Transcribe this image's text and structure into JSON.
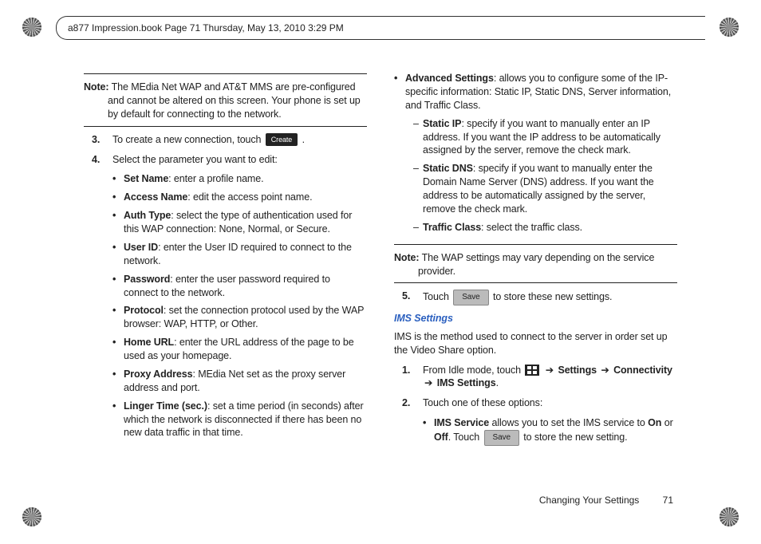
{
  "header": "a877 Impression.book  Page 71  Thursday, May 13, 2010  3:29 PM",
  "col1": {
    "note_label": "Note:",
    "note_text": "The MEdia Net WAP and AT&T MMS are pre-configured and cannot be altered on this screen. Your phone is set up by default for connecting to the network.",
    "step3": {
      "num": "3.",
      "text_before": "To create a new connection, touch ",
      "btn": "Create",
      "text_after": "."
    },
    "step4": {
      "num": "4.",
      "text": "Select the parameter you want to edit:"
    },
    "items": {
      "set_name": {
        "label": "Set Name",
        "desc": ": enter a profile name."
      },
      "access_name": {
        "label": "Access Name",
        "desc": ": edit the access point name."
      },
      "auth_type": {
        "label": "Auth Type",
        "desc": ": select the type of authentication used for this WAP connection: None, Normal, or Secure."
      },
      "user_id": {
        "label": "User ID",
        "desc": ": enter the User ID required to connect to the network."
      },
      "password": {
        "label": "Password",
        "desc": ": enter the user password required to connect to the network."
      },
      "protocol": {
        "label": "Protocol",
        "desc": ": set the connection protocol used by the WAP browser: WAP, HTTP, or Other."
      },
      "home_url": {
        "label": "Home URL",
        "desc": ": enter the URL address of the page to be used as your homepage."
      },
      "proxy": {
        "label": "Proxy Address",
        "desc": ": MEdia Net set as the proxy server address and port."
      },
      "linger": {
        "label": "Linger Time (sec.)",
        "desc": ": set a time period (in seconds) after which the network is disconnected if there has been no new data traffic in that time."
      }
    }
  },
  "col2": {
    "adv": {
      "label": "Advanced Settings",
      "desc": ": allows you to configure some of the IP-specific information: Static IP, Static DNS, Server information, and Traffic Class."
    },
    "static_ip": {
      "label": "Static IP",
      "desc": ": specify if you want to manually enter an IP address. If you want the IP address to be automatically assigned by the server, remove the check mark."
    },
    "static_dns": {
      "label": "Static DNS",
      "desc": ": specify if you want to manually enter the Domain Name Server (DNS) address. If you want the address to be automatically assigned by the server, remove the check mark."
    },
    "traffic": {
      "label": "Traffic Class",
      "desc": ": select the traffic class."
    },
    "note_label": "Note:",
    "note_text": "The WAP settings may vary depending on the service provider.",
    "step5": {
      "num": "5.",
      "text_before": "Touch ",
      "btn": "Save",
      "text_after": " to store these new settings."
    },
    "ims_heading": "IMS Settings",
    "ims_intro": "IMS is the method used to connect to the server in order set up the Video Share option.",
    "ims_step1": {
      "num": "1.",
      "pre": "From Idle mode, touch ",
      "arrow": "➔",
      "seg1": "Settings",
      "seg2": "Connectivity",
      "seg3": "IMS Settings",
      "period": "."
    },
    "ims_step2": {
      "num": "2.",
      "text": "Touch one of these options:"
    },
    "ims_service": {
      "label": "IMS Service",
      "mid": " allows you to set the IMS service to ",
      "on": "On",
      "or": " or ",
      "off": "Off",
      "dot": ". ",
      "touch": "Touch ",
      "btn": "Save",
      "after": " to store the new setting."
    }
  },
  "footer": {
    "section": "Changing Your Settings",
    "page": "71"
  }
}
